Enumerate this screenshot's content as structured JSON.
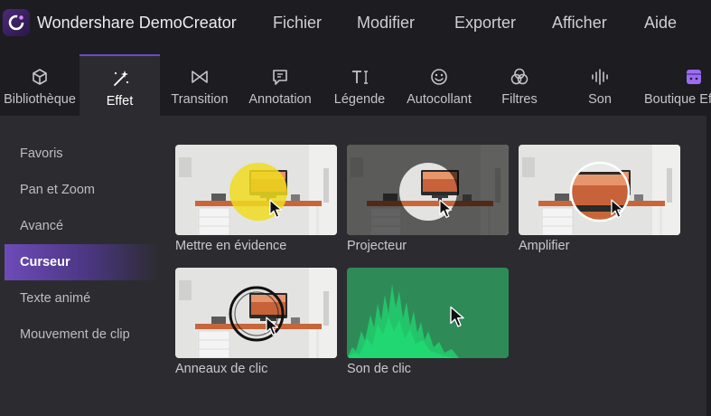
{
  "app": {
    "title": "Wondershare DemoCreator"
  },
  "menu": [
    "Fichier",
    "Modifier",
    "Exporter",
    "Afficher",
    "Aide"
  ],
  "toolbar": {
    "tabs": [
      {
        "label": "Bibliothèque",
        "icon": "cube-icon"
      },
      {
        "label": "Effet",
        "icon": "magic-wand-icon",
        "active": true
      },
      {
        "label": "Transition",
        "icon": "bowtie-icon"
      },
      {
        "label": "Annotation",
        "icon": "speech-bubble-icon"
      },
      {
        "label": "Légende",
        "icon": "text-cursor-icon"
      },
      {
        "label": "Autocollant",
        "icon": "smiley-icon"
      },
      {
        "label": "Filtres",
        "icon": "circles-icon"
      },
      {
        "label": "Son",
        "icon": "sound-wave-icon"
      },
      {
        "label": "Boutique Ef",
        "icon": "store-icon"
      }
    ]
  },
  "sidebar": {
    "items": [
      {
        "label": "Favoris"
      },
      {
        "label": "Pan et Zoom"
      },
      {
        "label": "Avancé"
      },
      {
        "label": "Curseur",
        "active": true
      },
      {
        "label": "Texte animé"
      },
      {
        "label": "Mouvement de clip"
      }
    ]
  },
  "effects": [
    {
      "label": "Mettre en évidence"
    },
    {
      "label": "Projecteur"
    },
    {
      "label": "Amplifier"
    },
    {
      "label": "Anneaux de clic"
    },
    {
      "label": "Son de clic"
    }
  ],
  "colors": {
    "accent": "#6f47c9",
    "sound_bg": "#2e8b57",
    "highlight": "#f0dc1e"
  }
}
